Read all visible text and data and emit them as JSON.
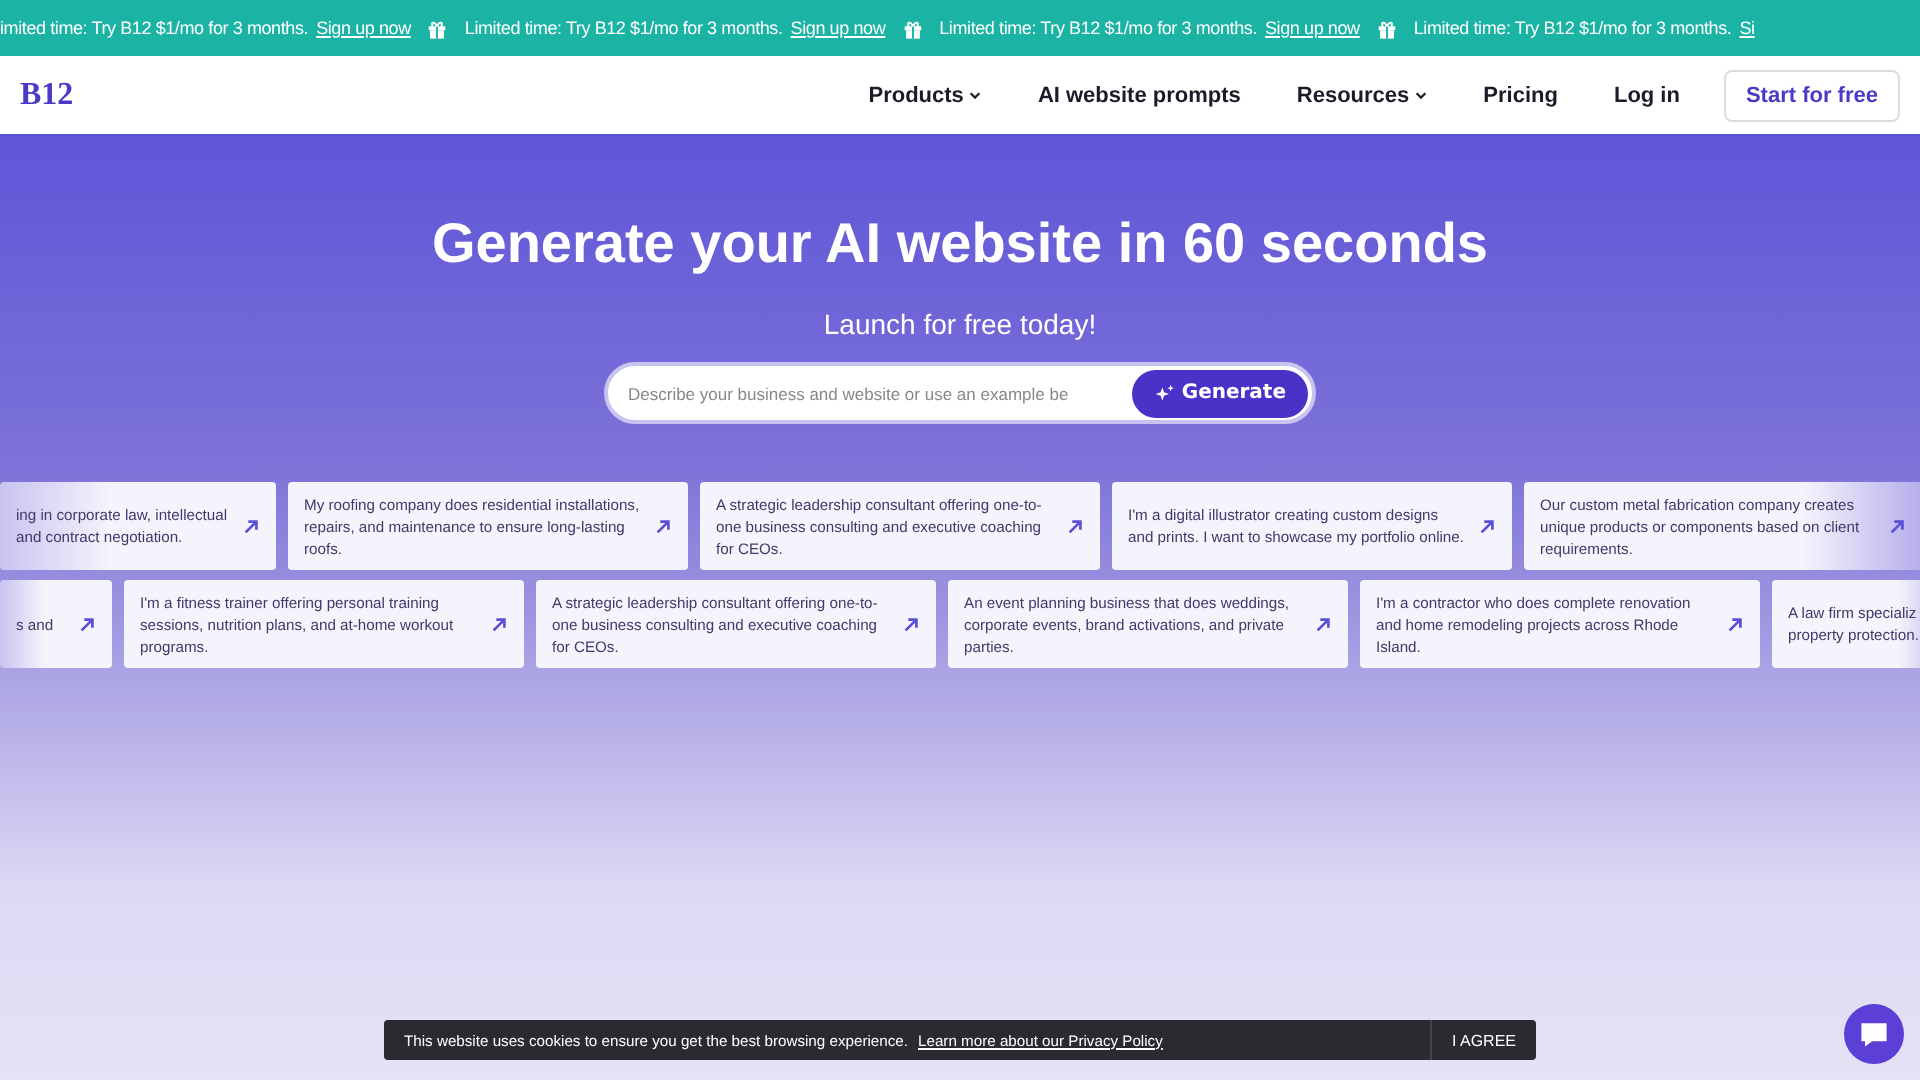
{
  "promo_banner": [
    {
      "text": "imited time: Try B12 $1/mo for 3 months.",
      "link": "Sign up now",
      "icon": false
    },
    {
      "text": "Limited time: Try B12 $1/mo for 3 months.",
      "link": "Sign up now",
      "icon": true
    },
    {
      "text": "Limited time: Try B12 $1/mo for 3 months.",
      "link": "Sign up now",
      "icon": true
    },
    {
      "text": "Limited time: Try B12 $1/mo for 3 months.",
      "link": "Si",
      "icon": true
    }
  ],
  "nav": {
    "logo": "B12",
    "items": [
      {
        "label": "Products",
        "dropdown": true
      },
      {
        "label": "AI website prompts",
        "dropdown": false
      },
      {
        "label": "Resources",
        "dropdown": true
      },
      {
        "label": "Pricing",
        "dropdown": false
      },
      {
        "label": "Log in",
        "dropdown": false
      }
    ],
    "cta": "Start for free"
  },
  "hero": {
    "title": "Generate your AI website in 60 seconds",
    "subtitle": "Launch for free today!",
    "search": {
      "placeholder": "Describe your business and website or use an example be",
      "button": "Generate"
    }
  },
  "example_rows": [
    [
      {
        "text": "ing in corporate law, intellectual and contract negotiation.",
        "kind": "partial-left"
      },
      {
        "text": "My roofing company does residential installations, repairs, and maintenance to ensure long-lasting roofs.",
        "kind": "full"
      },
      {
        "text": "A strategic leadership consultant offering one-to-one business consulting and executive coaching for CEOs.",
        "kind": "full"
      },
      {
        "text": "I'm a digital illustrator creating custom designs and prints. I want to showcase my portfolio online.",
        "kind": "full"
      },
      {
        "text": "Our custom metal fabrication company creates unique products or components based on client requirements.",
        "kind": "partial-right"
      }
    ],
    [
      {
        "text": "s and",
        "kind": "partial-left"
      },
      {
        "text": "I'm a fitness trainer offering personal training sessions, nutrition plans, and at-home workout programs.",
        "kind": "full"
      },
      {
        "text": "A strategic leadership consultant offering one-to-one business consulting and executive coaching for CEOs.",
        "kind": "full"
      },
      {
        "text": "An event planning business that does weddings, corporate events, brand activations, and private parties.",
        "kind": "full"
      },
      {
        "text": "I'm a contractor who does complete renovation and home remodeling projects across Rhode Island.",
        "kind": "full"
      },
      {
        "text": "A law firm specializ property protection.",
        "kind": "partial-right"
      }
    ]
  ],
  "cookie_bar": {
    "text": "This website uses cookies to ensure you get the best browsing experience.",
    "link": "Learn more about our Privacy Policy",
    "button": "I AGREE"
  }
}
